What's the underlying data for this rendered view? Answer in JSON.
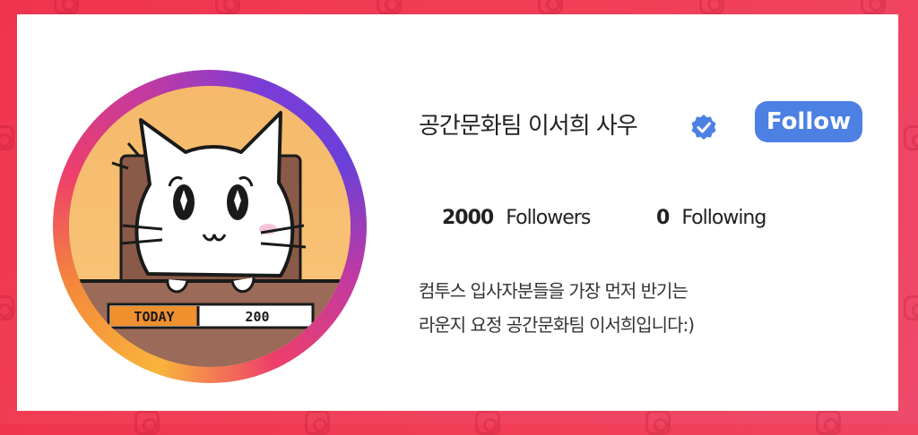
{
  "profile": {
    "name": "공간문화팀 이서희 사우",
    "verified": true,
    "follow_label": "Follow",
    "followers_count": "2000",
    "followers_label": "Followers",
    "following_count": "0",
    "following_label": "Following",
    "bio_line1": "컴투스 입사자분들을 가장 먼저 반기는",
    "bio_line2": "라운지 요정 공간문화팀 이서희입니다:)"
  },
  "avatar": {
    "sign_label": "TODAY",
    "sign_value": "200"
  },
  "colors": {
    "background": "#f0344f",
    "card": "#ffffff",
    "accent": "#4d80e3"
  }
}
